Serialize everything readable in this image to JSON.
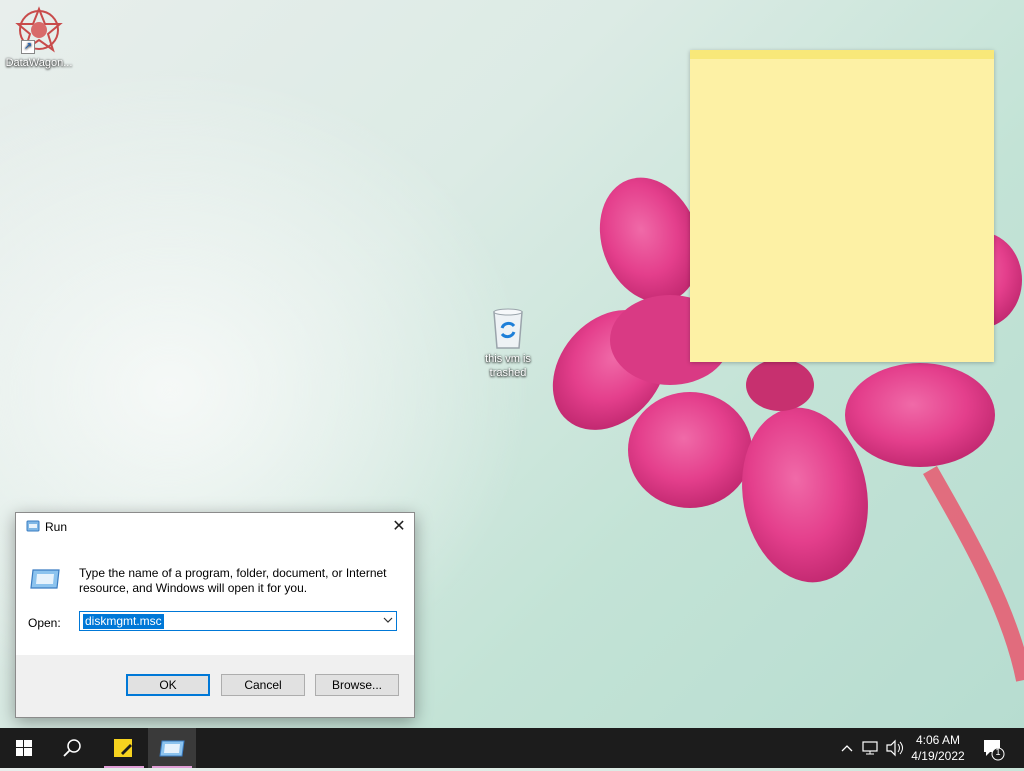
{
  "desktop": {
    "icons": [
      {
        "label": "DataWagon..."
      },
      {
        "label": "this vm is trashed"
      }
    ]
  },
  "run_dialog": {
    "title": "Run",
    "description": "Type the name of a program, folder, document, or Internet resource, and Windows will open it for you.",
    "open_label": "Open:",
    "open_value": "diskmgmt.msc",
    "ok_label": "OK",
    "cancel_label": "Cancel",
    "browse_label": "Browse..."
  },
  "taskbar": {
    "time": "4:06 AM",
    "date": "4/19/2022",
    "notification_count": "1"
  },
  "colors": {
    "accent": "#0078d7",
    "sticky_note": "#fdf1a5",
    "taskbar": "#1c1c1c"
  }
}
